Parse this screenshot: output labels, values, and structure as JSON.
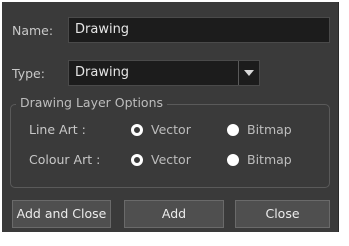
{
  "fields": {
    "name_label": "Name:",
    "name_value": "Drawing",
    "type_label": "Type:",
    "type_value": "Drawing"
  },
  "group": {
    "title": "Drawing Layer Options",
    "line_art": {
      "label": "Line Art :",
      "options": [
        "Vector",
        "Bitmap"
      ],
      "selected": "Vector"
    },
    "colour_art": {
      "label": "Colour Art :",
      "options": [
        "Vector",
        "Bitmap"
      ],
      "selected": "Vector"
    }
  },
  "buttons": {
    "add_and_close": "Add and Close",
    "add": "Add",
    "close": "Close"
  }
}
